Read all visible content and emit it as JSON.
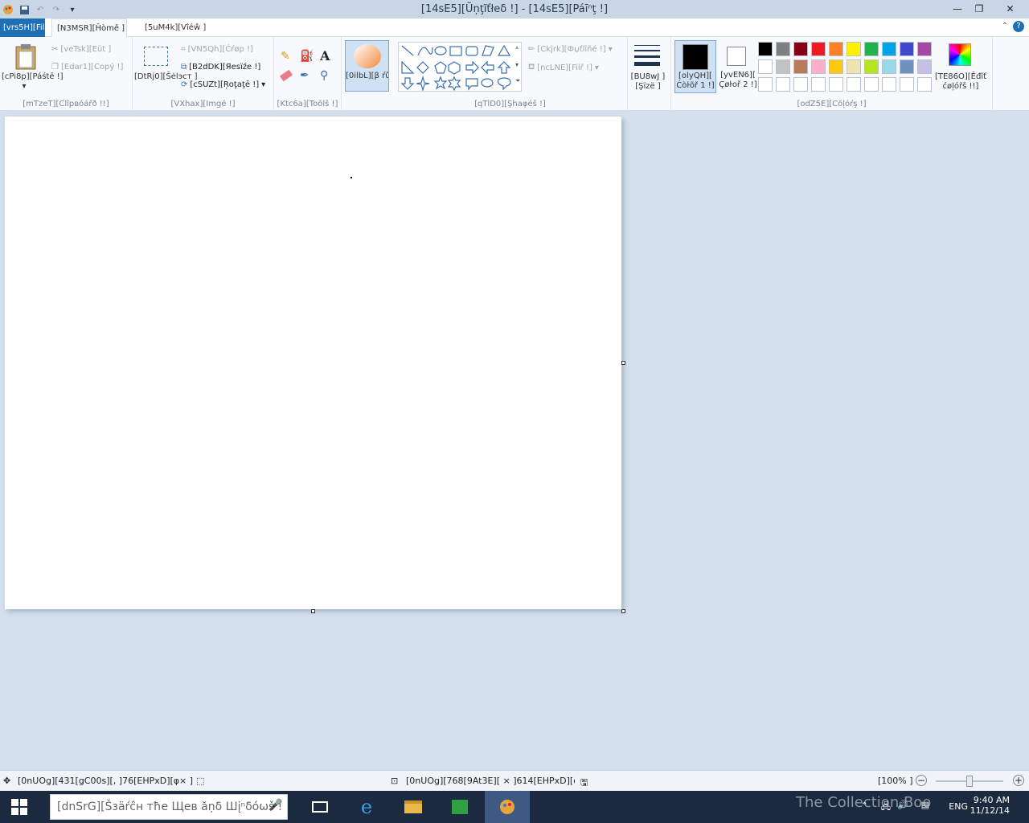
{
  "window": {
    "title": "[14sE5][Ũņţĩťłeδ !] - [14sE5][Páīⁿţ !]",
    "minimize": "—",
    "maximize": "❐",
    "close": "✕"
  },
  "tabs": {
    "file": "[vrs5H][Filë ]",
    "home": "[N3MSR][Ĥòmě ]",
    "view": "[5uM4k][Vîéŵ ]"
  },
  "clipboard": {
    "paste": "[cPi8p][Páśtē !]",
    "cut": "[veTsk][Eüt ]",
    "copy": "[Edar1][Copý !]",
    "label": "[mTzeT][Clîpвóářð !!]"
  },
  "image": {
    "select": "[DtRj0][Šėlэcт ]",
    "crop": "[VN5Qh][Ćŕøp !]",
    "resize": "[B2dDK][Яеsïźе !]",
    "rotate": "[cSUZt][Ŗoţaţē !]",
    "label": "[VXhax][Im͞gé !]"
  },
  "tools": {
    "label": "[Ktc6a][Toõĺš !]"
  },
  "brushes": {
    "label": "[0ilbL][β ŕůšђеš !]"
  },
  "shapes": {
    "outline": "[Ckjrk][Фџťlĩňé !]",
    "fill": "[ncLNE][Filř !]",
    "label": "[qTlD0][Şĥaφéš !]"
  },
  "size": {
    "label": "[BU8wJ ][Şïzë ]"
  },
  "colors": {
    "color1": "[olyQH][ Ćòŀõř 1 !]",
    "color2": "[yvEN6][ Çøŀoř 2 !]",
    "edit": "[TE86O][Ēđĭť ćøļóřš !!]",
    "label": "[odZ5E][Ĉŏļóŕş !]",
    "palette": [
      "#000000",
      "#7f7f7f",
      "#880015",
      "#ed1c24",
      "#ff7f27",
      "#fff200",
      "#22b14c",
      "#00a2e8",
      "#3f48cc",
      "#a349a4",
      "#ffffff",
      "#c3c3c3",
      "#b97a57",
      "#ffaec9",
      "#ffc90e",
      "#efe4b0",
      "#b5e61d",
      "#99d9ea",
      "#7092be",
      "#c8bfe7"
    ]
  },
  "status": {
    "position": "[0nUOg][431[gC00s][, ]76[EHPxD][φ× ] !!",
    "size": "[0nUOg][768[9At3E][ × ]614[EHPxD][φ×",
    "zoom": "[100% ]"
  },
  "taskbar": {
    "search": "[dnSrG][Šзäŕĉн тħе Щев ăņδ Шįⁿδóωš !",
    "lang": "ENG",
    "time": "9:40 AM",
    "date": "11/12/14",
    "watermark": "The Collection Book"
  }
}
